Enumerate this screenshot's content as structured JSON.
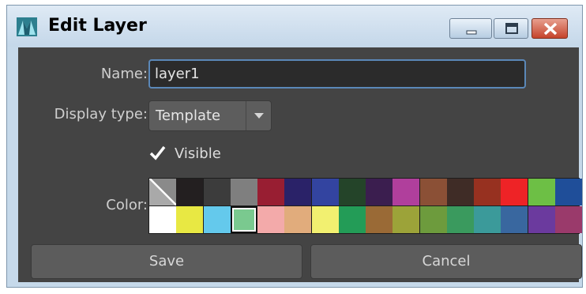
{
  "window": {
    "title": "Edit Layer"
  },
  "form": {
    "name_label": "Name:",
    "name_value": "layer1",
    "display_type_label": "Display type:",
    "display_type_value": "Template",
    "visible_label": "Visible",
    "visible_checked": true,
    "color_label": "Color:"
  },
  "palette": {
    "selected_index": 19,
    "swatches": [
      "none",
      "#231f20",
      "#3c3c3c",
      "#7f7f7f",
      "#981e32",
      "#2a2268",
      "#3344a0",
      "#244429",
      "#3b1e4f",
      "#b03f9c",
      "#8b5036",
      "#3f2c26",
      "#973120",
      "#ee2326",
      "#6dbf45",
      "#1f4e99",
      "#ffffff",
      "#e8e843",
      "#64c9ec",
      "#7ac98f",
      "#f3aaaa",
      "#e1ac7c",
      "#f2f070",
      "#239c57",
      "#9a6a36",
      "#9ca339",
      "#6d9b3d",
      "#3a9a5e",
      "#3b9a9a",
      "#39679f",
      "#6b3a9e",
      "#9a3a6b"
    ]
  },
  "buttons": {
    "save": "Save",
    "cancel": "Cancel"
  }
}
